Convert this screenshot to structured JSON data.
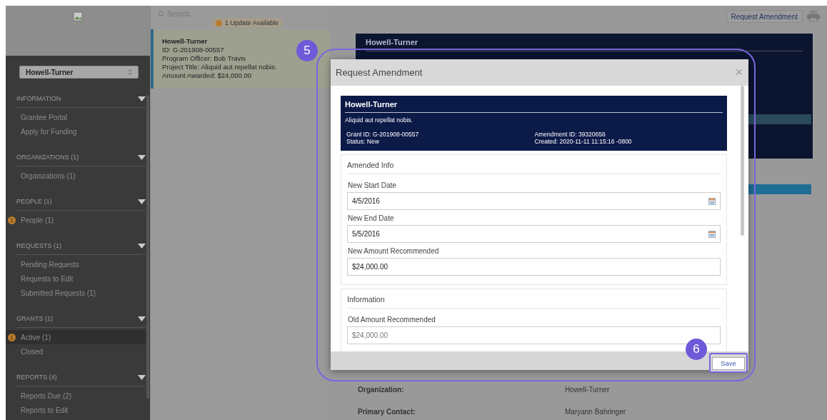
{
  "sidebar": {
    "org_select": "Howell-Turner",
    "sections": [
      {
        "title": "INFORMATION",
        "expanded": true,
        "items": [
          {
            "label": "Grantee Portal",
            "selected": false
          },
          {
            "label": "Apply for Funding",
            "selected": false
          }
        ]
      },
      {
        "title": "ORGANIZATIONS (1)",
        "expanded": true,
        "items": [
          {
            "label": "Organizations  (1)",
            "selected": false
          }
        ]
      },
      {
        "title": "PEOPLE (1)",
        "expanded": true,
        "items": [
          {
            "label": "People  (1)",
            "badge": "1",
            "selected": false
          }
        ]
      },
      {
        "title": "REQUESTS (1)",
        "expanded": true,
        "items": [
          {
            "label": "Pending Requests",
            "selected": false
          },
          {
            "label": "Requests to Edit",
            "selected": false
          },
          {
            "label": "Submitted Requests  (1)",
            "selected": false
          }
        ]
      },
      {
        "title": "GRANTS (1)",
        "expanded": true,
        "items": [
          {
            "label": "Active  (1)",
            "badge": "1",
            "selected": true
          },
          {
            "label": "Closed",
            "selected": false
          }
        ]
      },
      {
        "title": "REPORTS (4)",
        "expanded": true,
        "items": [
          {
            "label": "Reports Due  (2)",
            "selected": false
          },
          {
            "label": "Reports to Edit",
            "selected": false
          }
        ]
      }
    ]
  },
  "list": {
    "search": {
      "placeholder": "Search..."
    },
    "update_badge": "1 Update Available",
    "cards": [
      {
        "name": "Howell-Turner",
        "lines": [
          "ID: G-201908-00557",
          "Program Officer: Bob Travis",
          "Project Title: Aliquid aut repellat nobis.",
          "Amount Awarded: $24,000.00"
        ],
        "selected": true
      }
    ]
  },
  "toolbar": {
    "button": "Request Amendment"
  },
  "detail": {
    "header_title": "Howell-Turner",
    "rows": [
      {
        "label": "Organization:",
        "value": "Howell-Turner"
      },
      {
        "label": "Primary Contact:",
        "value": "Maryann Bahringer"
      }
    ]
  },
  "modal": {
    "title": "Request Amendment",
    "close": "×",
    "grant": {
      "name": "Howell-Turner",
      "subtitle": "Aliquid aut repellat nobis.",
      "grant_id": "Grant ID: G-201908-00557",
      "status": "Status: New",
      "amendment_id": "Amendment ID: 39320656",
      "created": "Created: 2020-11-11 11:15:16 -0800"
    },
    "sections": [
      {
        "title": "Amended Info",
        "fields": [
          {
            "label": "New Start Date",
            "value": "4/5/2016",
            "kind": "date",
            "disabled": false
          },
          {
            "label": "New End Date",
            "value": "5/5/2016",
            "kind": "date",
            "disabled": false
          },
          {
            "label": "New Amount Recommended",
            "value": "$24,000.00",
            "kind": "text",
            "disabled": false
          }
        ]
      },
      {
        "title": "Information",
        "fields": [
          {
            "label": "Old Amount Recommended",
            "value": "$24,000.00",
            "kind": "text",
            "disabled": true
          }
        ]
      }
    ],
    "save": "Save"
  },
  "annotations": [
    "5",
    "6"
  ]
}
